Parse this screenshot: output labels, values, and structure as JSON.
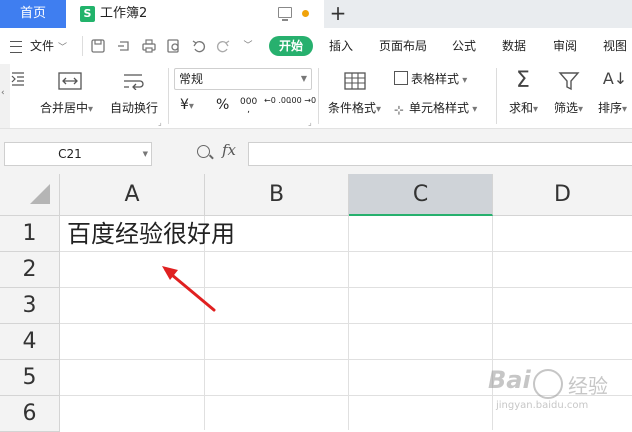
{
  "titlebar": {
    "home_tab": "首页",
    "doc_tab": "工作簿2",
    "doc_icon_letter": "S",
    "colors": {
      "home_bg": "#3f7ef0",
      "doc_icon": "#22b36b",
      "unsaved_dot": "#f0a30a"
    }
  },
  "menu": {
    "file": "文件",
    "start": "开始",
    "items": [
      "插入",
      "页面布局",
      "公式",
      "数据",
      "审阅",
      "视图"
    ],
    "accent": "#27b06e"
  },
  "ribbon": {
    "merge": "合并居中",
    "wrap": "自动换行",
    "number_format": "常规",
    "currency_symbol": "¥",
    "percent_symbol": "%",
    "thousands_symbol": "000",
    "dec_inc": "←0 .00",
    "dec_dec": ".00 →0",
    "table_style": "表格样式",
    "cond_format": "条件格式",
    "cell_style": "单元格样式",
    "sum": "求和",
    "filter": "筛选",
    "sort": "排序"
  },
  "formula_bar": {
    "name_box": "C21",
    "fx": "fx",
    "formula": ""
  },
  "sheet": {
    "columns": [
      "A",
      "B",
      "C",
      "D"
    ],
    "rows": [
      "1",
      "2",
      "3",
      "4",
      "5",
      "6"
    ],
    "selected_column": "C",
    "cell_A1": "百度经验很好用"
  },
  "watermark": {
    "brand": "Bai",
    "suffix": "经验",
    "url": "jingyan.baidu.com"
  },
  "annotation": {
    "arrow_color": "#e02020"
  }
}
